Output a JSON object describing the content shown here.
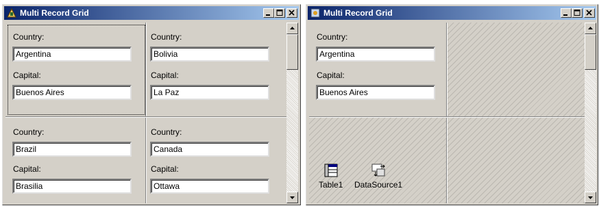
{
  "left_window": {
    "title": "Multi Record Grid",
    "records": [
      {
        "country_label": "Country:",
        "country": "Argentina",
        "capital_label": "Capital:",
        "capital": "Buenos Aires"
      },
      {
        "country_label": "Country:",
        "country": "Bolivia",
        "capital_label": "Capital:",
        "capital": "La Paz"
      },
      {
        "country_label": "Country:",
        "country": "Brazil",
        "capital_label": "Capital:",
        "capital": "Brasilia"
      },
      {
        "country_label": "Country:",
        "country": "Canada",
        "capital_label": "Capital:",
        "capital": "Ottawa"
      }
    ]
  },
  "right_window": {
    "title": "Multi Record Grid",
    "record": {
      "country_label": "Country:",
      "country": "Argentina",
      "capital_label": "Capital:",
      "capital": "Buenos Aires"
    },
    "components": [
      {
        "label": "Table1",
        "icon": "table-icon"
      },
      {
        "label": "DataSource1",
        "icon": "datasource-icon"
      }
    ]
  },
  "title_buttons": {
    "minimize": "minimize-icon",
    "maximize": "maximize-icon",
    "close": "close-icon"
  },
  "colors": {
    "title_start": "#0a246a",
    "title_end": "#a6caf0",
    "face": "#d4d0c8"
  }
}
